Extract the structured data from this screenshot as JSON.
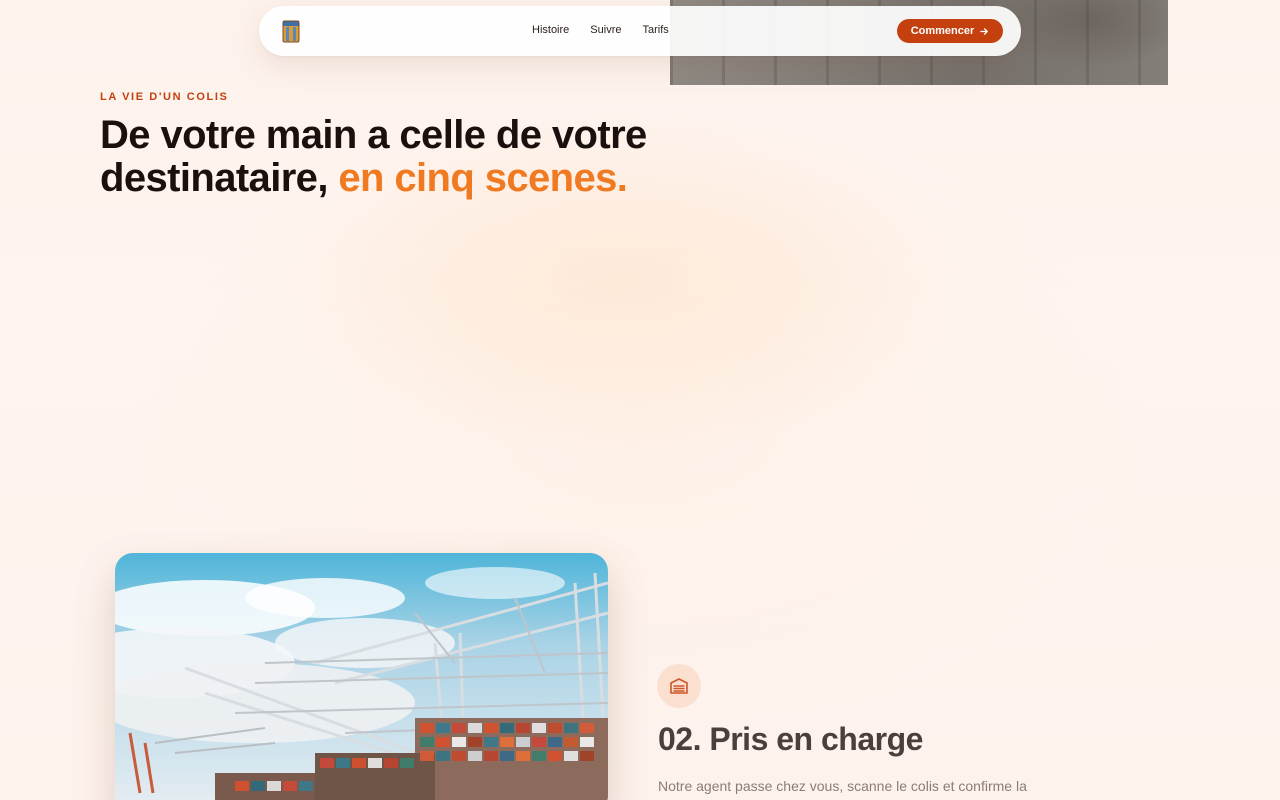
{
  "nav": {
    "links": [
      "Histoire",
      "Suivre",
      "Tarifs"
    ],
    "cta_label": "Commencer",
    "logo_icon": "package-box-icon",
    "cta_icon": "arrow-right-icon"
  },
  "hero": {
    "eyebrow": "LA VIE D'UN COLIS",
    "headline_part1": "De votre main a celle de votre destinataire,",
    "headline_accent": "en cinq scenes."
  },
  "scene": {
    "icon": "garage-icon",
    "title": "02. Pris en charge",
    "text": "Notre agent passe chez vous, scanne le colis et confirme la"
  },
  "colors": {
    "accent": "#c4410f",
    "highlight": "#f07a22",
    "background": "#fdf3ee",
    "heading": "#1a110e"
  }
}
